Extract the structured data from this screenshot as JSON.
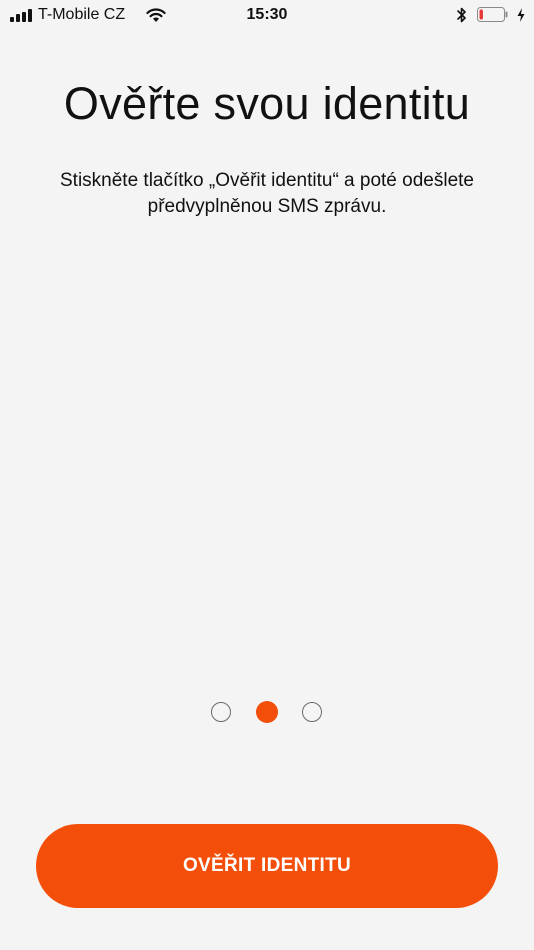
{
  "status_bar": {
    "carrier": "T-Mobile CZ",
    "time": "15:30",
    "battery_level": 0.15,
    "battery_color": "#e53935"
  },
  "content": {
    "title": "Ověřte svou identitu",
    "description": "Stiskněte tlačítko „Ověřit identitu“ a poté odešlete předvyplněnou SMS zprávu."
  },
  "pager": {
    "total_pages": 3,
    "current_page": 2
  },
  "primary_action": {
    "label": "OVĚŘIT IDENTITU"
  },
  "colors": {
    "accent": "#f44f0a",
    "background": "#f4f4f4",
    "text": "#111111"
  }
}
